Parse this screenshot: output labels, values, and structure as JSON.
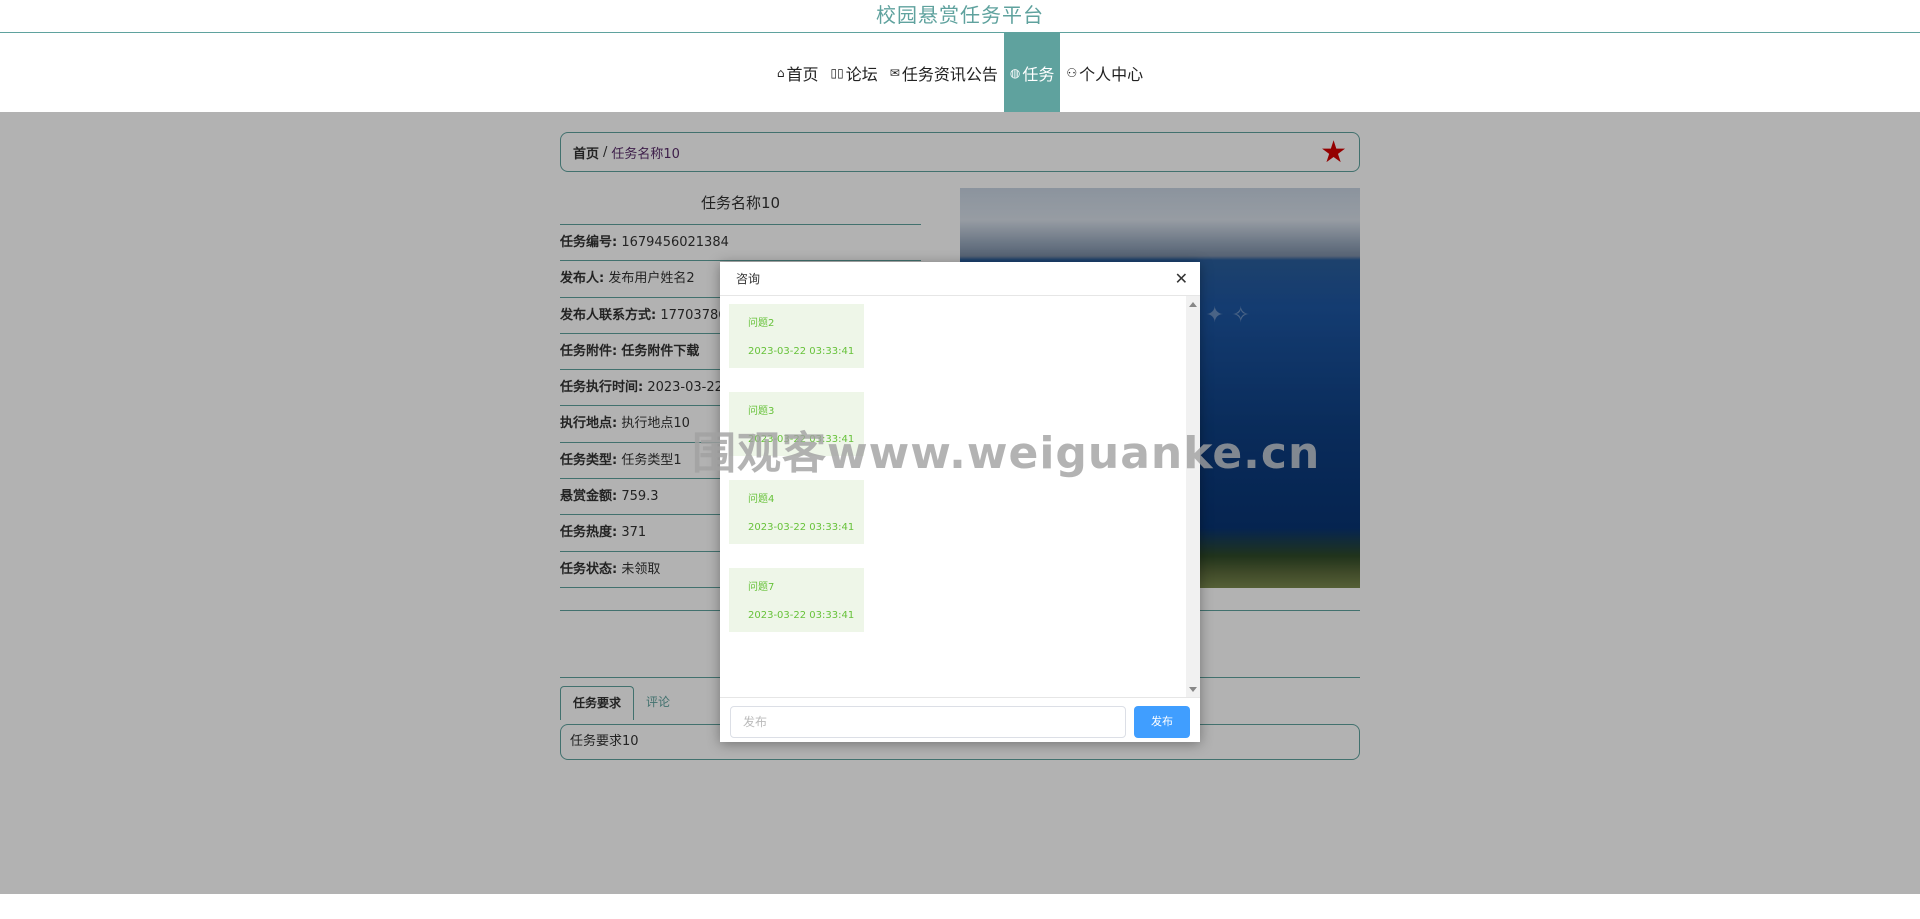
{
  "header": {
    "site_title": "校园悬赏任务平台"
  },
  "nav": {
    "items": [
      {
        "icon": "⌂",
        "label": "首页"
      },
      {
        "icon": "▯▯",
        "label": "论坛"
      },
      {
        "icon": "✉",
        "label": "任务资讯公告"
      },
      {
        "icon": "◍",
        "label": "任务"
      },
      {
        "icon": "⚇",
        "label": "个人中心"
      }
    ]
  },
  "breadcrumb": {
    "home": "首页",
    "sep": "/",
    "current": "任务名称10"
  },
  "task": {
    "title": "任务名称10",
    "fields": [
      {
        "k": "任务编号:",
        "v": "1679456021384"
      },
      {
        "k": "发布人:",
        "v": "发布用户姓名2"
      },
      {
        "k": "发布人联系方式:",
        "v": "1770378690"
      },
      {
        "k": "任务附件:",
        "v": "任务附件下载"
      },
      {
        "k": "任务执行时间:",
        "v": "2023-03-22 0"
      },
      {
        "k": "执行地点:",
        "v": "执行地点10"
      },
      {
        "k": "任务类型:",
        "v": "任务类型1"
      },
      {
        "k": "悬赏金额:",
        "v": "759.3"
      },
      {
        "k": "任务热度:",
        "v": "371"
      },
      {
        "k": "任务状态:",
        "v": "未领取"
      }
    ]
  },
  "tabs": [
    {
      "label": "任务要求"
    },
    {
      "label": "评论"
    }
  ],
  "requirement": "任务要求10",
  "watermark": "围观客www.weiguanke.cn",
  "dialog": {
    "title": "咨询",
    "messages": [
      {
        "q": "问题2",
        "time": "2023-03-22 03:33:41"
      },
      {
        "q": "问题3",
        "time": "2023-03-22 03:33:41"
      },
      {
        "q": "问题4",
        "time": "2023-03-22 03:33:41"
      },
      {
        "q": "问题7",
        "time": "2023-03-22 03:33:41"
      }
    ],
    "input_placeholder": "发布",
    "submit_label": "发布"
  }
}
